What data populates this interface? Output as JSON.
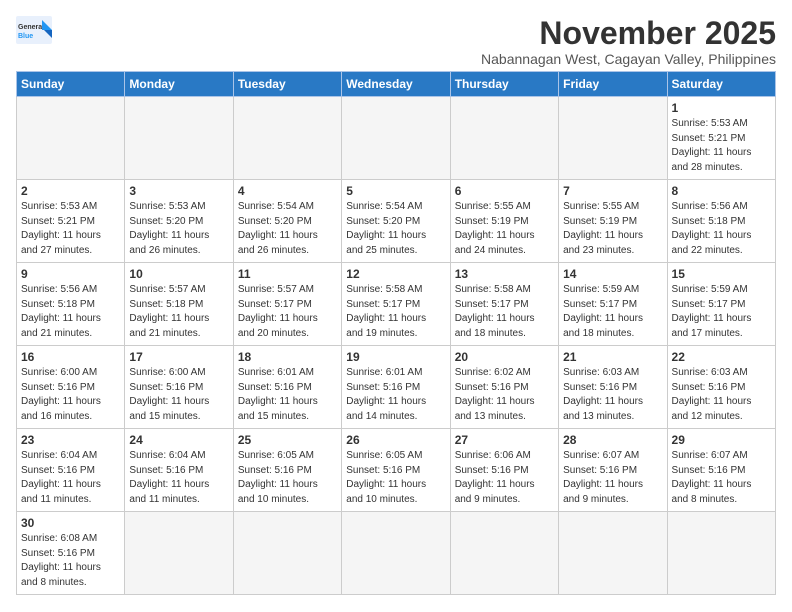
{
  "header": {
    "logo_line1": "General",
    "logo_line2": "Blue",
    "month_title": "November 2025",
    "subtitle": "Nabannagan West, Cagayan Valley, Philippines"
  },
  "weekdays": [
    "Sunday",
    "Monday",
    "Tuesday",
    "Wednesday",
    "Thursday",
    "Friday",
    "Saturday"
  ],
  "weeks": [
    [
      {
        "day": "",
        "info": ""
      },
      {
        "day": "",
        "info": ""
      },
      {
        "day": "",
        "info": ""
      },
      {
        "day": "",
        "info": ""
      },
      {
        "day": "",
        "info": ""
      },
      {
        "day": "",
        "info": ""
      },
      {
        "day": "1",
        "info": "Sunrise: 5:53 AM\nSunset: 5:21 PM\nDaylight: 11 hours\nand 28 minutes."
      }
    ],
    [
      {
        "day": "2",
        "info": "Sunrise: 5:53 AM\nSunset: 5:21 PM\nDaylight: 11 hours\nand 27 minutes."
      },
      {
        "day": "3",
        "info": "Sunrise: 5:53 AM\nSunset: 5:20 PM\nDaylight: 11 hours\nand 26 minutes."
      },
      {
        "day": "4",
        "info": "Sunrise: 5:54 AM\nSunset: 5:20 PM\nDaylight: 11 hours\nand 26 minutes."
      },
      {
        "day": "5",
        "info": "Sunrise: 5:54 AM\nSunset: 5:20 PM\nDaylight: 11 hours\nand 25 minutes."
      },
      {
        "day": "6",
        "info": "Sunrise: 5:55 AM\nSunset: 5:19 PM\nDaylight: 11 hours\nand 24 minutes."
      },
      {
        "day": "7",
        "info": "Sunrise: 5:55 AM\nSunset: 5:19 PM\nDaylight: 11 hours\nand 23 minutes."
      },
      {
        "day": "8",
        "info": "Sunrise: 5:56 AM\nSunset: 5:18 PM\nDaylight: 11 hours\nand 22 minutes."
      }
    ],
    [
      {
        "day": "9",
        "info": "Sunrise: 5:56 AM\nSunset: 5:18 PM\nDaylight: 11 hours\nand 21 minutes."
      },
      {
        "day": "10",
        "info": "Sunrise: 5:57 AM\nSunset: 5:18 PM\nDaylight: 11 hours\nand 21 minutes."
      },
      {
        "day": "11",
        "info": "Sunrise: 5:57 AM\nSunset: 5:17 PM\nDaylight: 11 hours\nand 20 minutes."
      },
      {
        "day": "12",
        "info": "Sunrise: 5:58 AM\nSunset: 5:17 PM\nDaylight: 11 hours\nand 19 minutes."
      },
      {
        "day": "13",
        "info": "Sunrise: 5:58 AM\nSunset: 5:17 PM\nDaylight: 11 hours\nand 18 minutes."
      },
      {
        "day": "14",
        "info": "Sunrise: 5:59 AM\nSunset: 5:17 PM\nDaylight: 11 hours\nand 18 minutes."
      },
      {
        "day": "15",
        "info": "Sunrise: 5:59 AM\nSunset: 5:17 PM\nDaylight: 11 hours\nand 17 minutes."
      }
    ],
    [
      {
        "day": "16",
        "info": "Sunrise: 6:00 AM\nSunset: 5:16 PM\nDaylight: 11 hours\nand 16 minutes."
      },
      {
        "day": "17",
        "info": "Sunrise: 6:00 AM\nSunset: 5:16 PM\nDaylight: 11 hours\nand 15 minutes."
      },
      {
        "day": "18",
        "info": "Sunrise: 6:01 AM\nSunset: 5:16 PM\nDaylight: 11 hours\nand 15 minutes."
      },
      {
        "day": "19",
        "info": "Sunrise: 6:01 AM\nSunset: 5:16 PM\nDaylight: 11 hours\nand 14 minutes."
      },
      {
        "day": "20",
        "info": "Sunrise: 6:02 AM\nSunset: 5:16 PM\nDaylight: 11 hours\nand 13 minutes."
      },
      {
        "day": "21",
        "info": "Sunrise: 6:03 AM\nSunset: 5:16 PM\nDaylight: 11 hours\nand 13 minutes."
      },
      {
        "day": "22",
        "info": "Sunrise: 6:03 AM\nSunset: 5:16 PM\nDaylight: 11 hours\nand 12 minutes."
      }
    ],
    [
      {
        "day": "23",
        "info": "Sunrise: 6:04 AM\nSunset: 5:16 PM\nDaylight: 11 hours\nand 11 minutes."
      },
      {
        "day": "24",
        "info": "Sunrise: 6:04 AM\nSunset: 5:16 PM\nDaylight: 11 hours\nand 11 minutes."
      },
      {
        "day": "25",
        "info": "Sunrise: 6:05 AM\nSunset: 5:16 PM\nDaylight: 11 hours\nand 10 minutes."
      },
      {
        "day": "26",
        "info": "Sunrise: 6:05 AM\nSunset: 5:16 PM\nDaylight: 11 hours\nand 10 minutes."
      },
      {
        "day": "27",
        "info": "Sunrise: 6:06 AM\nSunset: 5:16 PM\nDaylight: 11 hours\nand 9 minutes."
      },
      {
        "day": "28",
        "info": "Sunrise: 6:07 AM\nSunset: 5:16 PM\nDaylight: 11 hours\nand 9 minutes."
      },
      {
        "day": "29",
        "info": "Sunrise: 6:07 AM\nSunset: 5:16 PM\nDaylight: 11 hours\nand 8 minutes."
      }
    ],
    [
      {
        "day": "30",
        "info": "Sunrise: 6:08 AM\nSunset: 5:16 PM\nDaylight: 11 hours\nand 8 minutes."
      },
      {
        "day": "",
        "info": ""
      },
      {
        "day": "",
        "info": ""
      },
      {
        "day": "",
        "info": ""
      },
      {
        "day": "",
        "info": ""
      },
      {
        "day": "",
        "info": ""
      },
      {
        "day": "",
        "info": ""
      }
    ]
  ]
}
